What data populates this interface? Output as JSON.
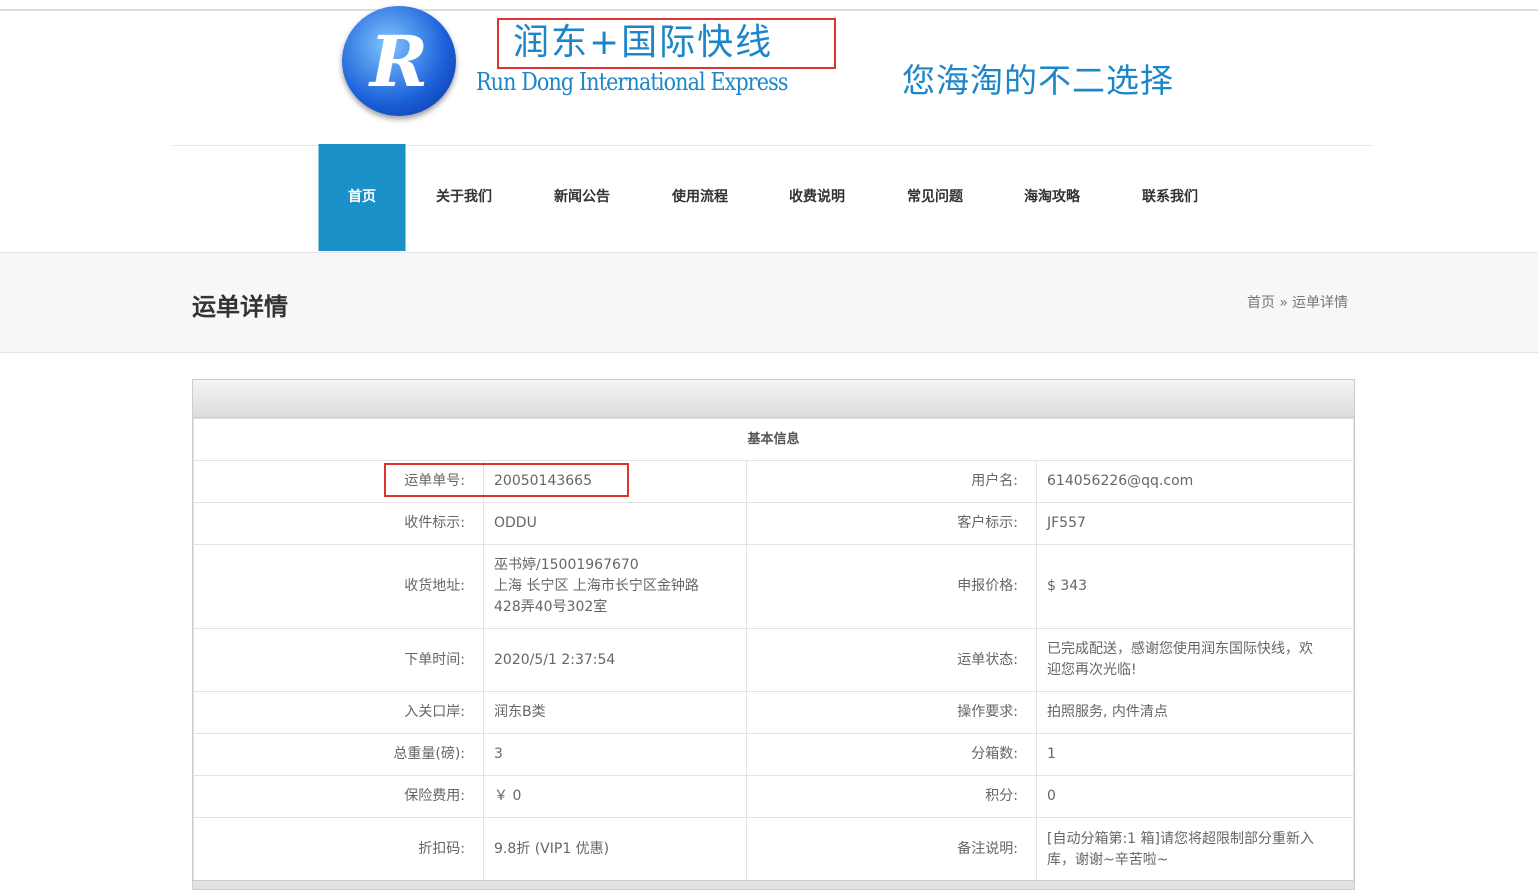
{
  "header": {
    "logo_letter": "R",
    "cn_name": "润东+国际快线",
    "en_name": "Run Dong International Express",
    "slogan": "您海淘的不二选择"
  },
  "nav": [
    "首页",
    "关于我们",
    "新闻公告",
    "使用流程",
    "收费说明",
    "常见问题",
    "海淘攻略",
    "联系我们"
  ],
  "page": {
    "title": "运单详情",
    "breadcrumb": [
      "首页 »",
      "运单详情"
    ]
  },
  "table": {
    "section": "基本信息",
    "rows": [
      [
        "运单单号:",
        "20050143665",
        "用户名:",
        "614056226@qq.com"
      ],
      [
        "收件标示:",
        "ODDU",
        "客户标示:",
        "JF557"
      ],
      [
        "收货地址:",
        "巫书婷/15001967670\n上海 长宁区 上海市长宁区金钟路\n428弄40号302室",
        "申报价格:",
        "$ 343"
      ],
      [
        "下单时间:",
        "2020/5/1 2:37:54",
        "运单状态:",
        "已完成配送，感谢您使用润东国际快线，欢\n迎您再次光临!"
      ],
      [
        "入关口岸:",
        "润东B类",
        "操作要求:",
        "拍照服务, 内件清点"
      ],
      [
        "总重量(磅):",
        "3",
        "分箱数:",
        "1"
      ],
      [
        "保险费用:",
        "￥ 0",
        "积分:",
        "0"
      ],
      [
        "折扣码:",
        "9.8折 (VIP1 优惠)",
        "备注说明:",
        "[自动分箱第:1 箱]请您将超限制部分重新入\n库，谢谢~辛苦啦~"
      ]
    ]
  }
}
